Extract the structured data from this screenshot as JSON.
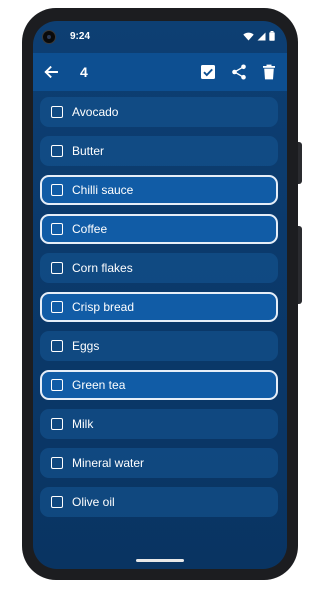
{
  "status_bar": {
    "time": "9:24",
    "icons": [
      "wifi-icon",
      "signal-icon",
      "battery-icon"
    ]
  },
  "app_bar": {
    "title": "4",
    "back_icon": "arrow-left-icon",
    "actions": [
      "check-box-icon",
      "share-icon",
      "trash-icon"
    ]
  },
  "list": {
    "items": [
      {
        "label": "Avocado",
        "selected": false
      },
      {
        "label": "Butter",
        "selected": false
      },
      {
        "label": "Chilli sauce",
        "selected": true
      },
      {
        "label": "Coffee",
        "selected": true
      },
      {
        "label": "Corn flakes",
        "selected": false
      },
      {
        "label": "Crisp bread",
        "selected": true
      },
      {
        "label": "Eggs",
        "selected": false
      },
      {
        "label": "Green tea",
        "selected": true
      },
      {
        "label": "Milk",
        "selected": false
      },
      {
        "label": "Mineral water",
        "selected": false
      },
      {
        "label": "Olive oil",
        "selected": false
      }
    ]
  },
  "colors": {
    "app_bar": "#0d4f91",
    "background": "#0b3a6c",
    "item": "#165896",
    "selected_item": "#115ca6",
    "selected_border": "#e6eef8"
  }
}
